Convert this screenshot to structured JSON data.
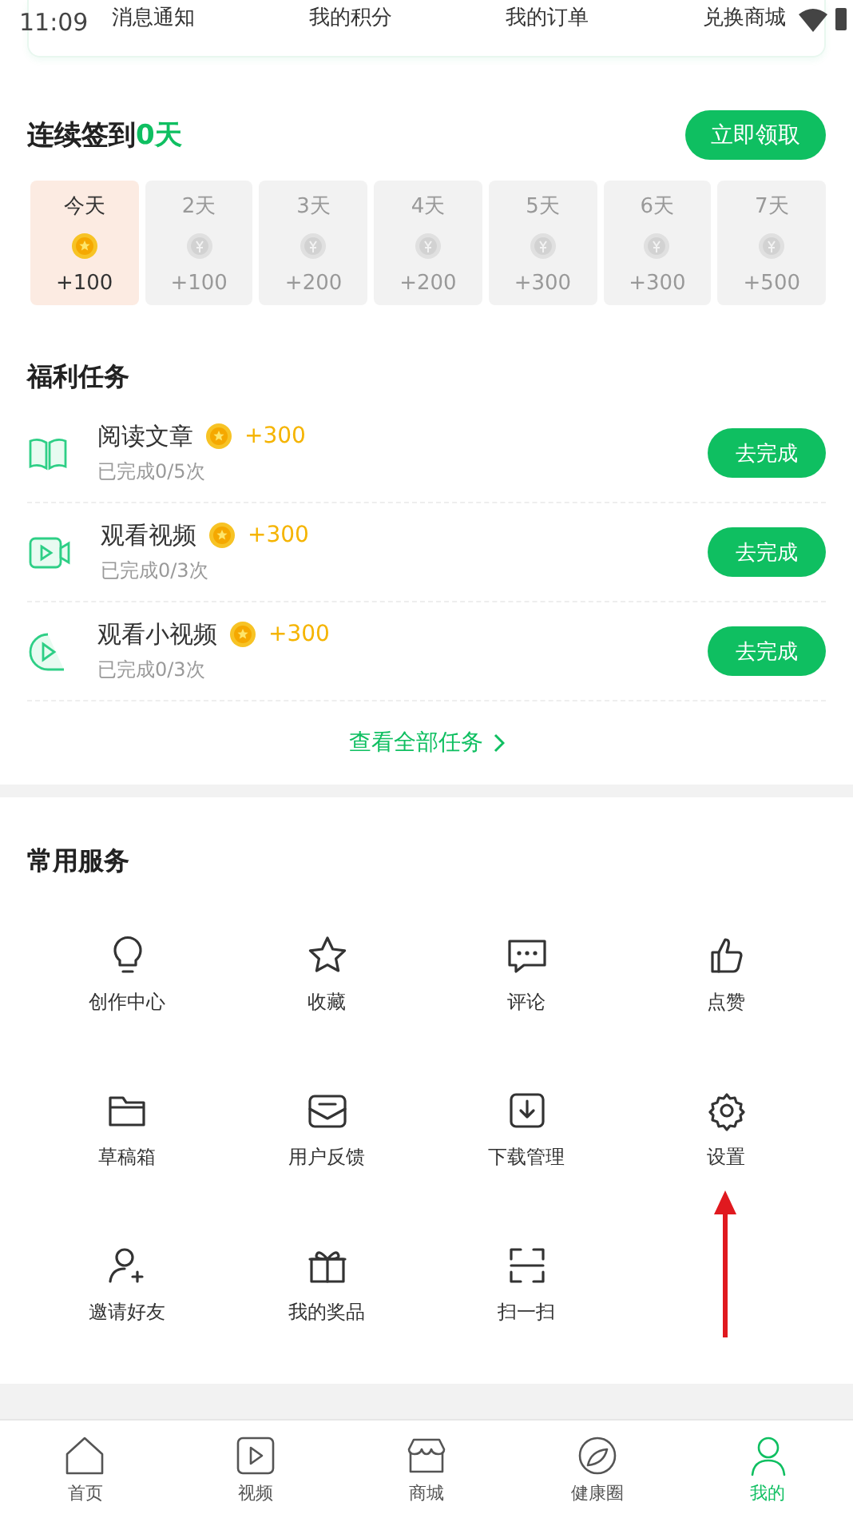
{
  "status_bar": {
    "time": "11:09"
  },
  "top_menu": [
    "消息通知",
    "我的积分",
    "我的订单",
    "兑换商城"
  ],
  "signin": {
    "title": "连续签到",
    "count": "0天",
    "button": "立即领取",
    "days": [
      {
        "label": "今天",
        "points": "+100",
        "selected": true
      },
      {
        "label": "2天",
        "points": "+100",
        "selected": false
      },
      {
        "label": "3天",
        "points": "+200",
        "selected": false
      },
      {
        "label": "4天",
        "points": "+200",
        "selected": false
      },
      {
        "label": "5天",
        "points": "+300",
        "selected": false
      },
      {
        "label": "6天",
        "points": "+300",
        "selected": false
      },
      {
        "label": "7天",
        "points": "+500",
        "selected": false
      }
    ]
  },
  "tasks": {
    "title": "福利任务",
    "more": "查看全部任务",
    "items": [
      {
        "kind": "book",
        "name": "阅读文章",
        "points": "+300",
        "progress": "已完成0/5次",
        "button": "去完成"
      },
      {
        "kind": "video",
        "name": "观看视频",
        "points": "+300",
        "progress": "已完成0/3次",
        "button": "去完成"
      },
      {
        "kind": "clip",
        "name": "观看小视频",
        "points": "+300",
        "progress": "已完成0/3次",
        "button": "去完成"
      }
    ]
  },
  "services": {
    "title": "常用服务",
    "items": [
      {
        "kind": "bulb",
        "label": "创作中心"
      },
      {
        "kind": "star",
        "label": "收藏"
      },
      {
        "kind": "comment",
        "label": "评论"
      },
      {
        "kind": "like",
        "label": "点赞"
      },
      {
        "kind": "folder",
        "label": "草稿箱"
      },
      {
        "kind": "feedback",
        "label": "用户反馈"
      },
      {
        "kind": "download",
        "label": "下载管理"
      },
      {
        "kind": "gear",
        "label": "设置"
      },
      {
        "kind": "invite",
        "label": "邀请好友"
      },
      {
        "kind": "gift",
        "label": "我的奖品"
      },
      {
        "kind": "scan",
        "label": "扫一扫"
      }
    ]
  },
  "bottom_nav": [
    {
      "kind": "home",
      "label": "首页",
      "selected": false
    },
    {
      "kind": "video",
      "label": "视频",
      "selected": false
    },
    {
      "kind": "shop",
      "label": "商城",
      "selected": false
    },
    {
      "kind": "health",
      "label": "健康圈",
      "selected": false
    },
    {
      "kind": "me",
      "label": "我的",
      "selected": true
    }
  ]
}
